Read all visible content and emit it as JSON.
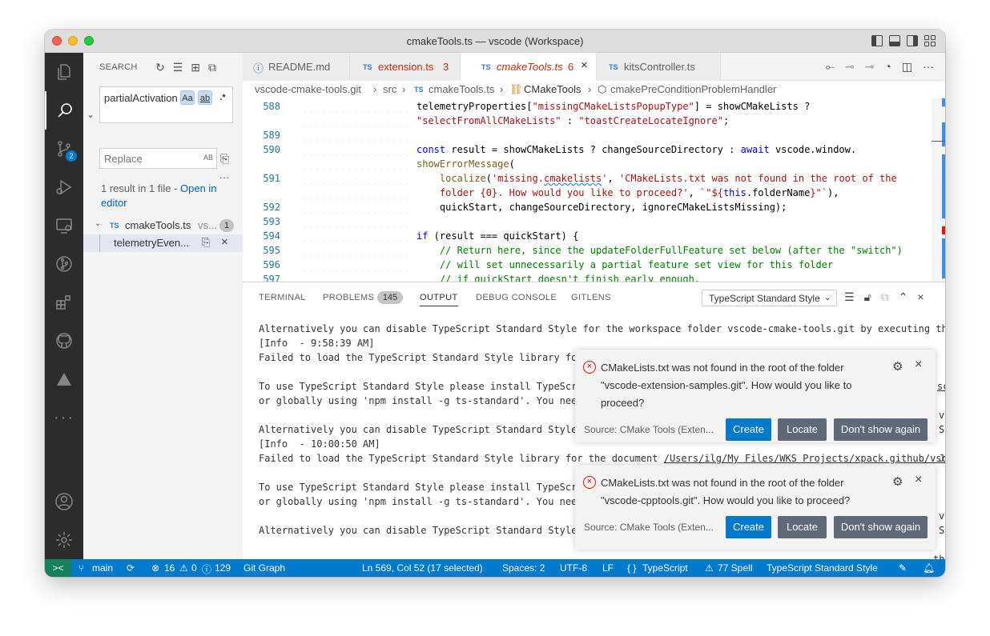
{
  "window": {
    "title": "cmakeTools.ts — vscode (Workspace)"
  },
  "activity": {
    "source_control_badge": "2"
  },
  "sidebar": {
    "title": "SEARCH",
    "search_value": "partialActivation",
    "opt_case": "Aa",
    "opt_word": "ab",
    "opt_regex": ".*",
    "replace_placeholder": "Replace",
    "replace_preserve": "AB",
    "more": "...",
    "result_summary": "1 result in 1 file - ",
    "open_in_editor": "Open in editor",
    "file": {
      "name": "cmakeTools.ts",
      "path": "vs...",
      "count": "1"
    },
    "match": {
      "text": "telemetryEven..."
    }
  },
  "tabs": [
    {
      "label": "README.md"
    },
    {
      "label": "extension.ts",
      "problems": "3"
    },
    {
      "label": "cmakeTools.ts",
      "problems": "6"
    },
    {
      "label": "kitsController.ts"
    }
  ],
  "ts_label": "TS",
  "breadcrumb": {
    "repo": "vscode-cmake-tools.git",
    "src": "src",
    "file": "cmakeTools.ts",
    "class": "CMakeTools",
    "method": "cmakePreConditionProblemHandler"
  },
  "code": {
    "line_numbers": [
      "588",
      "",
      "589",
      "590",
      "",
      "591",
      "",
      "592",
      "593",
      "594",
      "595",
      "596",
      "597"
    ]
  },
  "panel": {
    "tabs": [
      "TERMINAL",
      "PROBLEMS",
      "OUTPUT",
      "DEBUG CONSOLE",
      "GITLENS"
    ],
    "problems_count": "145",
    "channel": "TypeScript Standard Style",
    "output_lines": [
      "Alternatively you can disable TypeScript Standard Style for the workspace folder vscode-cmake-tools.git by executing th",
      "[Info  - 9:58:39 AM]",
      "Failed to load the TypeScript Standard Style library fo",
      "",
      "To use TypeScript Standard Style please install TypeScr",
      "or globally using 'npm install -g ts-standard'. You nee",
      "",
      "Alternatively you can disable TypeScript Standard Style",
      "[Info  - 10:00:50 AM]",
      "Failed to load the TypeScript Standard Style library for the document ",
      "",
      "To use TypeScript Standard Style please install TypeScr",
      "or globally using 'npm install -g ts-standard'. You nee",
      "",
      "Alternatively you can disable TypeScript Standard Style"
    ],
    "output_path": "/Users/ilg/My Files/WKS Projects/xpack.github/vsc",
    "right_frag_1": "sc",
    "right_frag_2": "v",
    "right_frag_3": "S",
    "right_frag_4": "J",
    "right_frag_5": "v",
    "right_frag_6": "S",
    "right_frag_7": "th"
  },
  "notifications": [
    {
      "message": "CMakeLists.txt was not found in the root of the folder \"vscode-extension-samples.git\". How would you like to proceed?",
      "source": "Source: CMake Tools (Exten...",
      "buttons": [
        "Create",
        "Locate",
        "Don't show again"
      ]
    },
    {
      "message": "CMakeLists.txt was not found in the root of the folder \"vscode-cpptools.git\". How would you like to proceed?",
      "source": "Source: CMake Tools (Exten...",
      "buttons": [
        "Create",
        "Locate",
        "Don't show again"
      ]
    }
  ],
  "statusbar": {
    "remote": "><",
    "branch": "main",
    "errors": "16",
    "warnings": "0",
    "infos": "129",
    "git_graph": "Git Graph",
    "position": "Ln 569, Col 52 (17 selected)",
    "spaces": "Spaces: 2",
    "encoding": "UTF-8",
    "eol": "LF",
    "language": "TypeScript",
    "spell": "77 Spell",
    "linter": "TypeScript Standard Style"
  }
}
